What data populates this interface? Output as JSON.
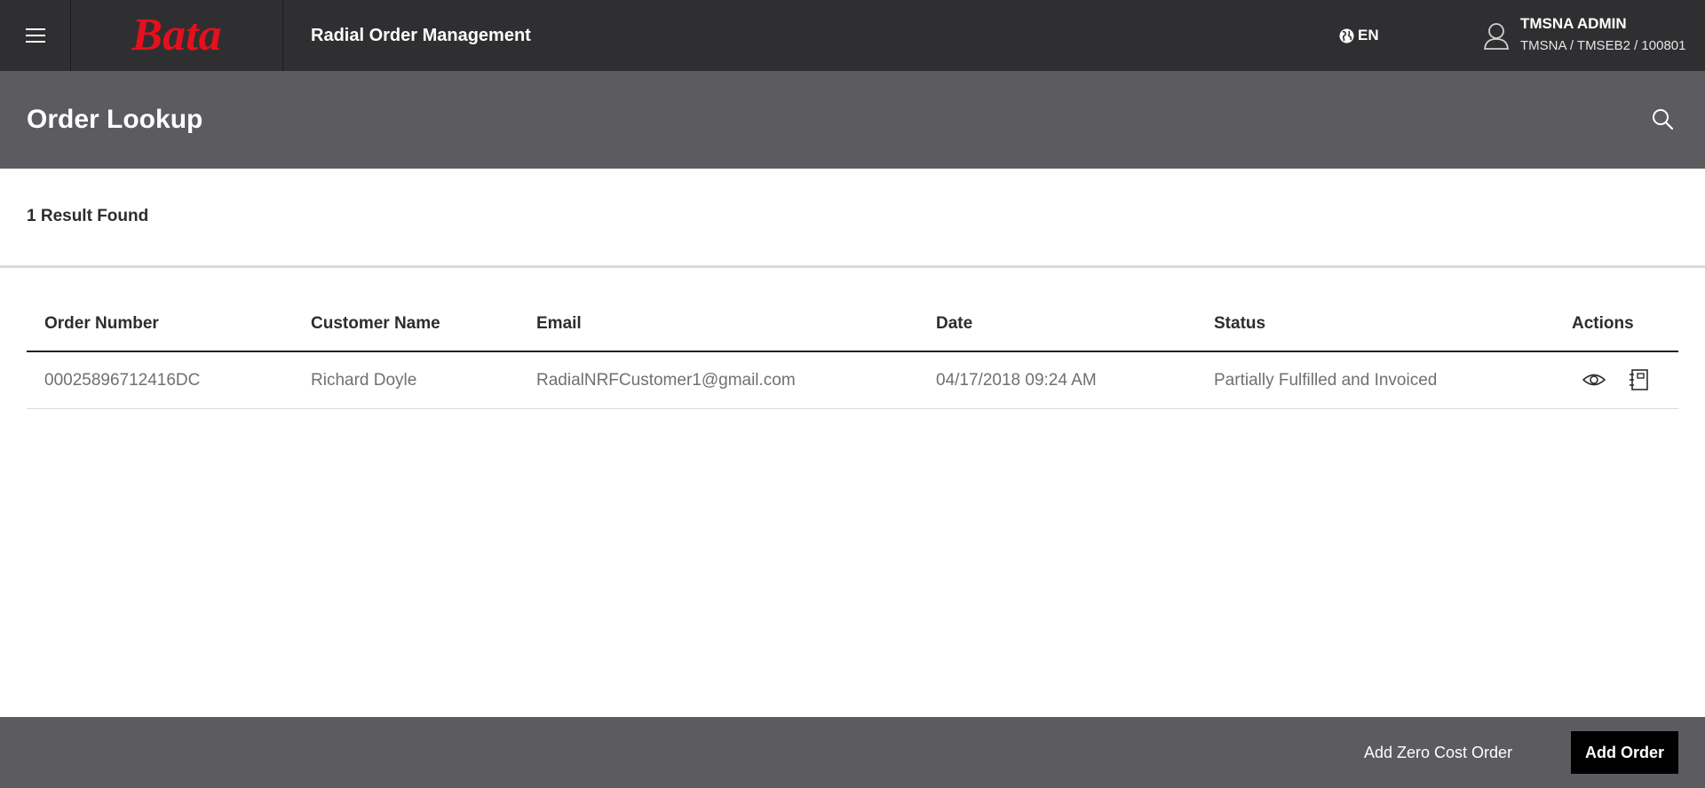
{
  "topbar": {
    "brand": "Bata",
    "app_title": "Radial Order Management",
    "language": "EN",
    "user_name": "TMSNA ADMIN",
    "user_context": "TMSNA / TMSEB2 / 100801",
    "brand_color": "#e4101d",
    "icons": {
      "menu": "hamburger-icon",
      "language": "globe-icon",
      "user": "user-icon"
    }
  },
  "page": {
    "title": "Order Lookup",
    "search_icon": "search-icon"
  },
  "results": {
    "count_label": "1 Result Found"
  },
  "table": {
    "columns": [
      "Order Number",
      "Customer Name",
      "Email",
      "Date",
      "Status",
      "Actions"
    ],
    "rows": [
      {
        "order_number": "00025896712416DC",
        "customer_name": "Richard Doyle",
        "email": "RadialNRFCustomer1@gmail.com",
        "date": "04/17/2018 09:24 AM",
        "status": "Partially Fulfilled and Invoiced",
        "actions": [
          "eye-icon",
          "notes-icon"
        ]
      }
    ]
  },
  "footer": {
    "zero_cost_label": "Add Zero Cost Order",
    "add_order_label": "Add Order"
  }
}
